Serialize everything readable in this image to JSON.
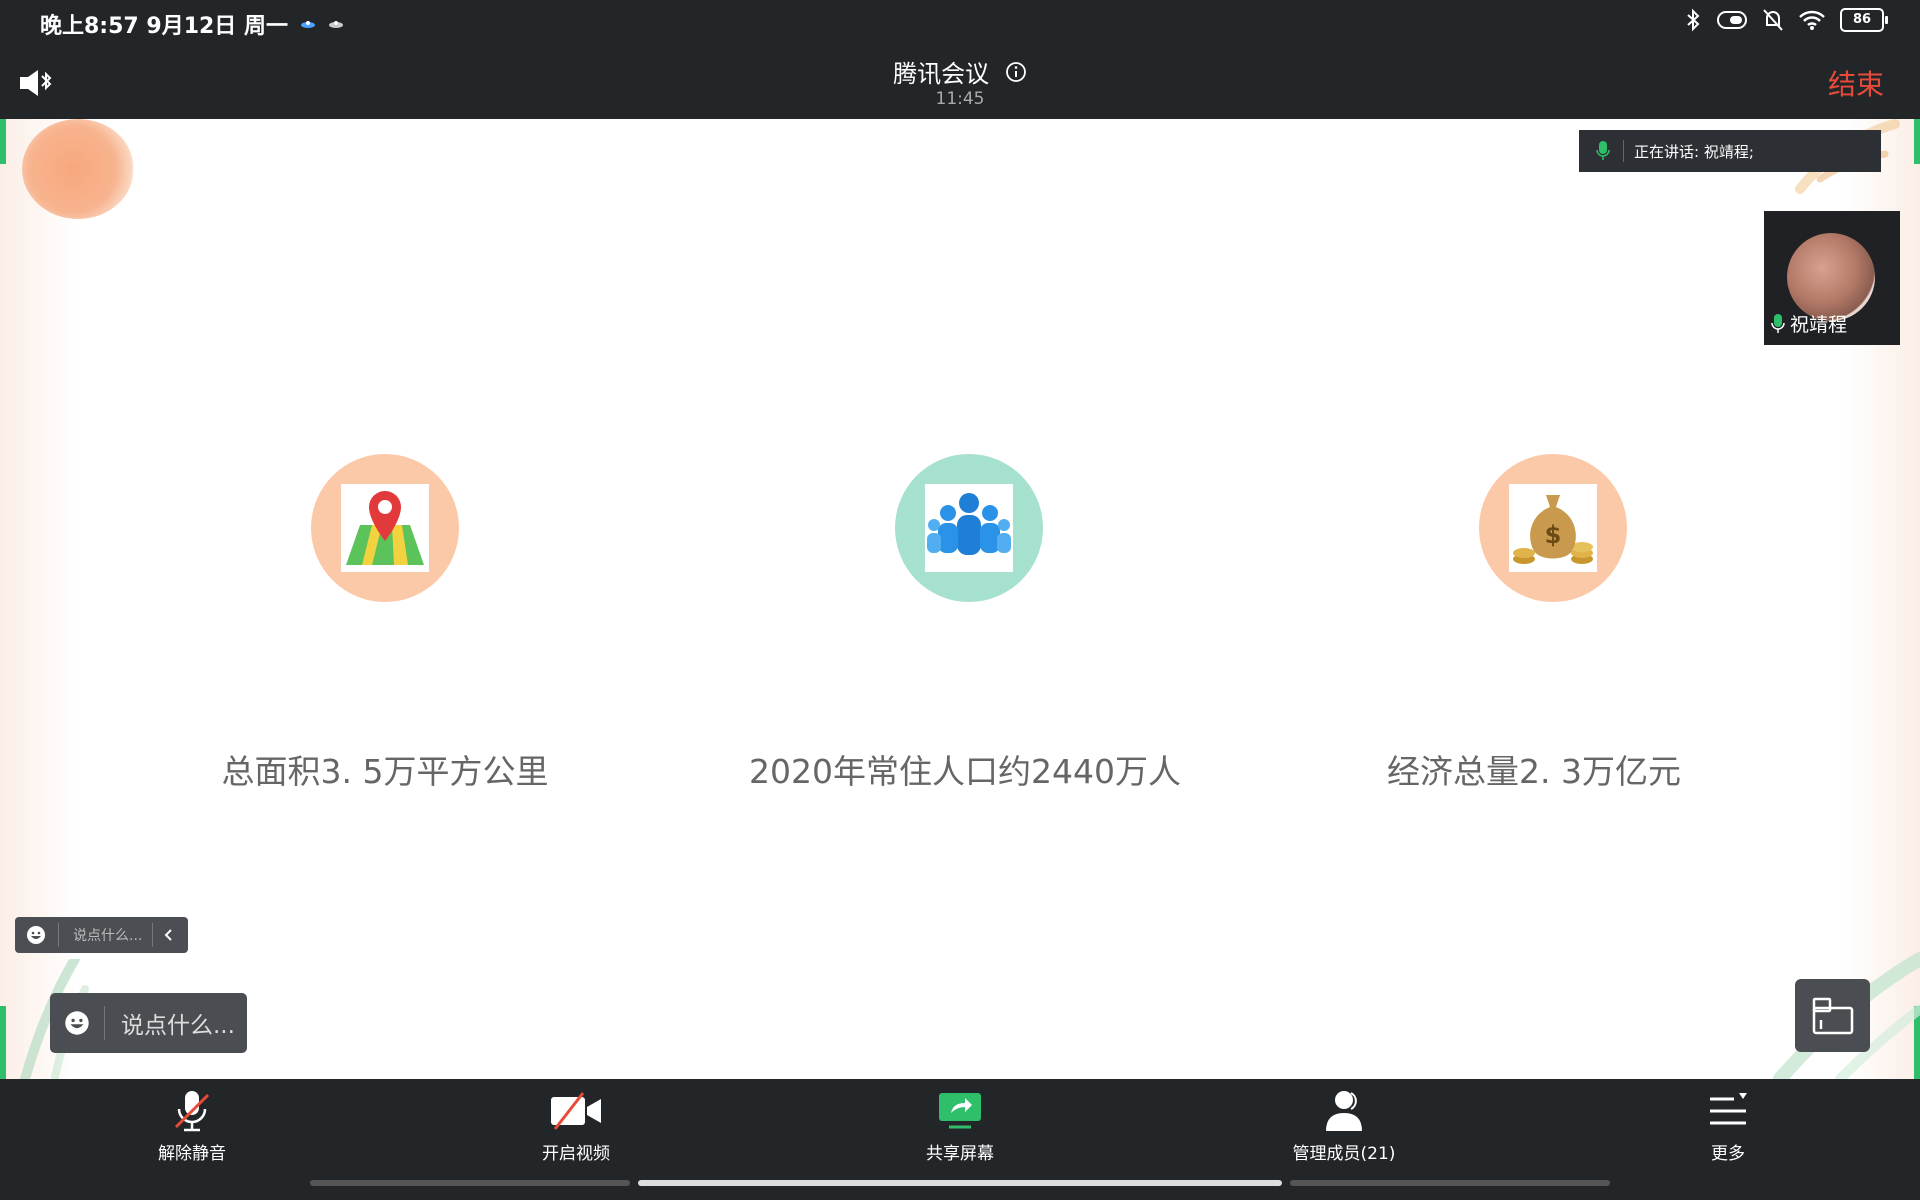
{
  "status_bar": {
    "datetime": "晚上8:57  9月12日 周一",
    "battery": "86"
  },
  "header": {
    "title": "腾讯会议",
    "duration": "11:45",
    "end_label": "结束"
  },
  "speaking": {
    "label": "正在讲话: 祝靖程;"
  },
  "participant": {
    "name": "祝靖程"
  },
  "slide": {
    "stats": [
      {
        "icon": "map-pin-icon",
        "label": "总面积3. 5万平方公里",
        "circle_color": "#fbc9a8"
      },
      {
        "icon": "people-icon",
        "label": "2020年常住人口约2440万人",
        "circle_color": "#a6e0cf"
      },
      {
        "icon": "money-bag-icon",
        "label": "经济总量2. 3万亿元",
        "circle_color": "#fbc9a8"
      }
    ]
  },
  "chat": {
    "placeholder": "说点什么..."
  },
  "toolbar": {
    "unmute": "解除静音",
    "video": "开启视频",
    "share": "共享屏幕",
    "members": "管理成员(21)",
    "more": "更多"
  },
  "colors": {
    "bar_bg": "#232629",
    "end_red": "#e84a3a",
    "accent_green": "#2fbf6a"
  }
}
